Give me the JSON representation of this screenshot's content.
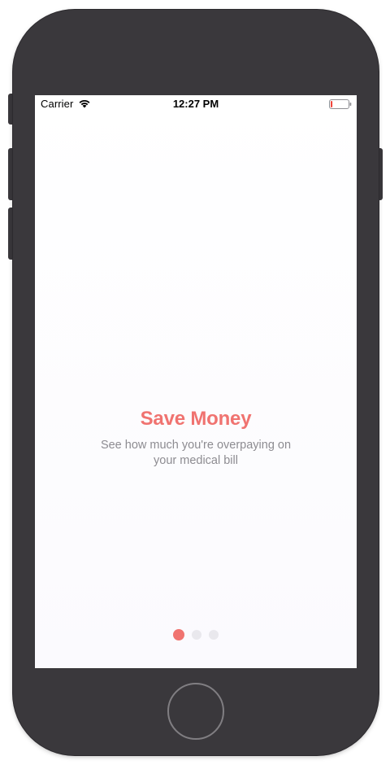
{
  "device": {
    "frame_color": "#3a383c",
    "home_button_color": "#807e82"
  },
  "status_bar": {
    "carrier": "Carrier",
    "time": "12:27 PM",
    "wifi_icon": "wifi-icon",
    "battery_icon": "battery-icon",
    "battery_level": 0.1,
    "battery_color": "#f0463c"
  },
  "onboarding": {
    "title": "Save Money",
    "subtitle": "See how much you're overpaying on your medical bill",
    "accent_color": "#f07370",
    "subtitle_color": "#8d8c91"
  },
  "pager": {
    "page_count": 3,
    "current_page": 1
  }
}
